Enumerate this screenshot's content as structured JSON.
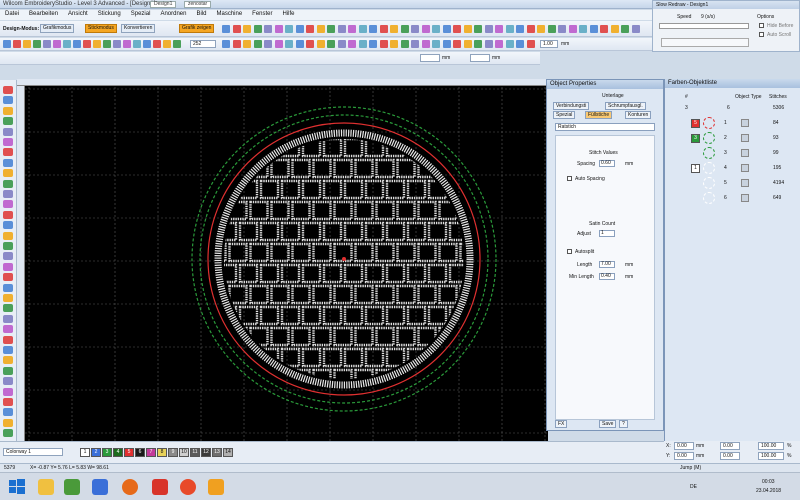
{
  "window": {
    "title": "Wilcom EmbroideryStudio - Level 3 Advanced - [Design1]",
    "tab1": "Design1",
    "tab2": "zenostar"
  },
  "menu": [
    "Datei",
    "Bearbeiten",
    "Ansicht",
    "Stickung",
    "Spezial",
    "Anordnen",
    "Bild",
    "Maschine",
    "Fenster",
    "Hilfe"
  ],
  "toolbar": {
    "mode_label": "Design-Modus:",
    "graphic_mode": "Grafikmodus",
    "stitch_mode": "Stickmodus",
    "convert": "Konvertieren",
    "show_graphic": "Grafik zeigen",
    "zoom_value": "252",
    "size_value": "1.00",
    "size_unit": "mm",
    "mm1": "mm",
    "mm2": "mm"
  },
  "redraw_panel": {
    "title": "Slow Redraw - Design1",
    "speed_label": "Speed",
    "speed_value": "9 (s/s)",
    "options_label": "Options",
    "opt1": "Hide Before",
    "opt2": "Auto Scroll"
  },
  "object_properties": {
    "title": "Object Properties",
    "tabs": {
      "underlay": "Unterlage",
      "connectors": "Verbindungsti",
      "pull_comp": "Schrumpfausgl.",
      "special": "Spezial",
      "fill": "Füllstiche",
      "outlines": "Konturen"
    },
    "stitch_type": "Ratstich",
    "stitch_values": "Stitch Values",
    "spacing_label": "Spacing",
    "spacing_value": "0.60",
    "spacing_unit": "mm",
    "auto_spacing": "Auto Spacing",
    "satin_count": "Satin Count",
    "adjust_label": "Adjust",
    "adjust_value": "1",
    "autosplit": "Autosplit",
    "length_label": "Length",
    "length_value": "7.00",
    "length_unit": "mm",
    "min_length_label": "Min Length",
    "min_length_value": "0.40",
    "min_length_unit": "mm",
    "fx_button": "FX",
    "save_button": "Save",
    "help_button": "?"
  },
  "color_list": {
    "title": "Farben-Objektliste",
    "col_num": "#",
    "col_object_type": "Object Type",
    "col_stitches": "Stitches",
    "header_count": "3",
    "header_num": "6",
    "header_stitches": "5306",
    "rows": [
      {
        "color_no": "5",
        "index": "1",
        "stitches": "84",
        "color": "#e03030"
      },
      {
        "color_no": "3",
        "index": "2",
        "stitches": "93",
        "color": "#2a9a3a"
      },
      {
        "color_no": "",
        "index": "3",
        "stitches": "99",
        "color": "#2a9a3a"
      },
      {
        "color_no": "1",
        "index": "4",
        "stitches": "195",
        "color": "#ffffff"
      },
      {
        "color_no": "",
        "index": "5",
        "stitches": "4194",
        "color": "#ffffff"
      },
      {
        "color_no": "",
        "index": "6",
        "stitches": "649",
        "color": "#ffffff"
      }
    ]
  },
  "colorbar": {
    "palette_name": "Colorway 1",
    "swatches": [
      "1",
      "2",
      "3",
      "4",
      "5",
      "6",
      "7",
      "8",
      "9",
      "10",
      "11",
      "12",
      "13",
      "14"
    ],
    "swatch_colors": [
      "#ffffff",
      "#3a6fd8",
      "#2a9a3a",
      "#1d6b1d",
      "#e03030",
      "#1a1a1a",
      "#c23b9a",
      "#e8d25a",
      "#8a8a8a",
      "#cfcfcf",
      "#5a5a5a",
      "#3a3a3a",
      "#6e6e6e",
      "#b0b0b0"
    ]
  },
  "status": {
    "stitch_count": "5379",
    "coords": "X= -0.87  Y= 5.76  L= 5.83  W= 98.61",
    "jump": "Jump (M)"
  },
  "coord_panel": {
    "x_label": "X:",
    "x_value": "0.00",
    "x_unit": "mm",
    "y_label": "Y:",
    "y_value": "0.00",
    "y_unit": "mm",
    "w_value": "0.00",
    "h_value": "0.00",
    "pct1": "100.00",
    "pct2": "100.00",
    "pct_unit": "%"
  },
  "taskbar": {
    "lang": "DE",
    "time": "00:03",
    "date": "23.04.2018"
  }
}
